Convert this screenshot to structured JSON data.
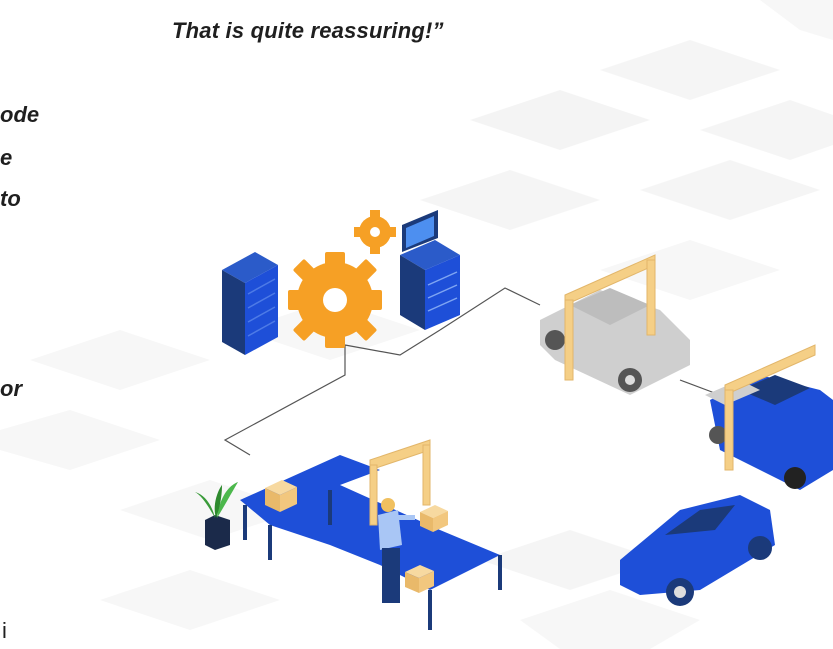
{
  "quote": {
    "line": "That is quite reassuring!”"
  },
  "left_fragments": [
    {
      "id": "frag-1",
      "text": "ode"
    },
    {
      "id": "frag-2",
      "text": "e"
    },
    {
      "id": "frag-3",
      "text": "to"
    },
    {
      "id": "frag-4",
      "text": "or"
    },
    {
      "id": "frag-5",
      "text": "i"
    }
  ],
  "colors": {
    "primary_blue": "#1e4fd8",
    "dark_navy": "#1b3a7a",
    "gear_orange": "#f6a025",
    "box_tan": "#f2c77e",
    "gantry_tan": "#f5cf86",
    "car_grey": "#cfcfcf",
    "tile_grey": "#eeeeee"
  },
  "icons": [
    "server-rack-icon",
    "gear-icon",
    "computer-terminal-icon",
    "plant-icon",
    "package-icon",
    "car-icon",
    "gantry-scanner-icon",
    "worker-icon"
  ]
}
